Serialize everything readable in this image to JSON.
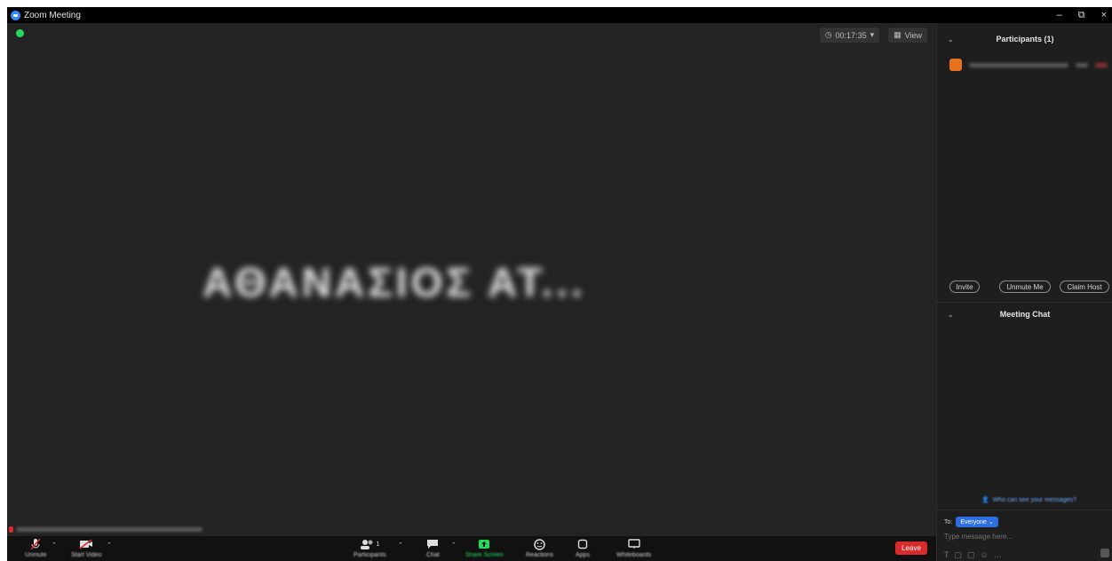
{
  "window": {
    "title": "Zoom Meeting",
    "controls": {
      "minimize": "–",
      "restore": "⧉",
      "close": "×"
    }
  },
  "stage": {
    "timer": "00:17:35",
    "view_label": "View",
    "participant_name": "ΑΘΑΝΑΣΙΟΣ ΑΤ...",
    "name_tag_icon": "muted-mic-icon"
  },
  "toolbar": {
    "left": [
      {
        "label": "Unmute",
        "icon": "muted-mic-icon"
      },
      {
        "label": "Start Video",
        "icon": "video-off-icon"
      }
    ],
    "center": [
      {
        "label": "Participants",
        "icon": "participants-icon",
        "badge": "1"
      },
      {
        "label": "Chat",
        "icon": "chat-icon"
      },
      {
        "label": "Share Screen",
        "icon": "share-screen-icon"
      },
      {
        "label": "Reactions",
        "icon": "reactions-icon"
      },
      {
        "label": "Apps",
        "icon": "apps-icon"
      },
      {
        "label": "Whiteboards",
        "icon": "whiteboard-icon"
      }
    ],
    "leave_label": "Leave"
  },
  "participants_panel": {
    "title": "Participants (1)",
    "buttons": {
      "invite": "Invite",
      "unmute_me": "Unmute Me",
      "claim_host": "Claim Host"
    }
  },
  "chat_panel": {
    "title": "Meeting Chat",
    "who_can_see": "Who can see your messages?",
    "to_label": "To:",
    "recipient": "Everyone",
    "input_placeholder": "Type message here..."
  },
  "colors": {
    "accent": "#2d8cff",
    "leave": "#d82b2b",
    "share_green": "#23d95c",
    "avatar_orange": "#e8711e"
  }
}
